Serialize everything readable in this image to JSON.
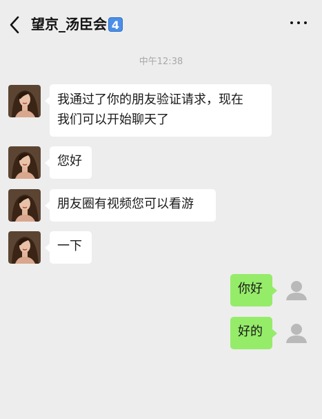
{
  "header": {
    "title": "望京_汤臣会",
    "badge": "4",
    "back_icon": "chevron-left-icon",
    "more_icon": "more-dots-icon"
  },
  "timestamp": "中午12:38",
  "messages": [
    {
      "from": "contact",
      "lines": [
        "我通过了你的朋友验证请求，现在",
        "我们可以开始聊天了"
      ]
    },
    {
      "from": "contact",
      "lines": [
        "您好"
      ]
    },
    {
      "from": "contact",
      "lines": [
        "朋友圈有视频您可以看游"
      ]
    },
    {
      "from": "contact",
      "lines": [
        "一下"
      ]
    },
    {
      "from": "me",
      "lines": [
        "你好"
      ]
    },
    {
      "from": "me",
      "lines": [
        "好的"
      ]
    }
  ],
  "colors": {
    "background": "#ededed",
    "incoming_bubble": "#ffffff",
    "outgoing_bubble": "#95ec69",
    "badge": "#4a8fe8"
  }
}
